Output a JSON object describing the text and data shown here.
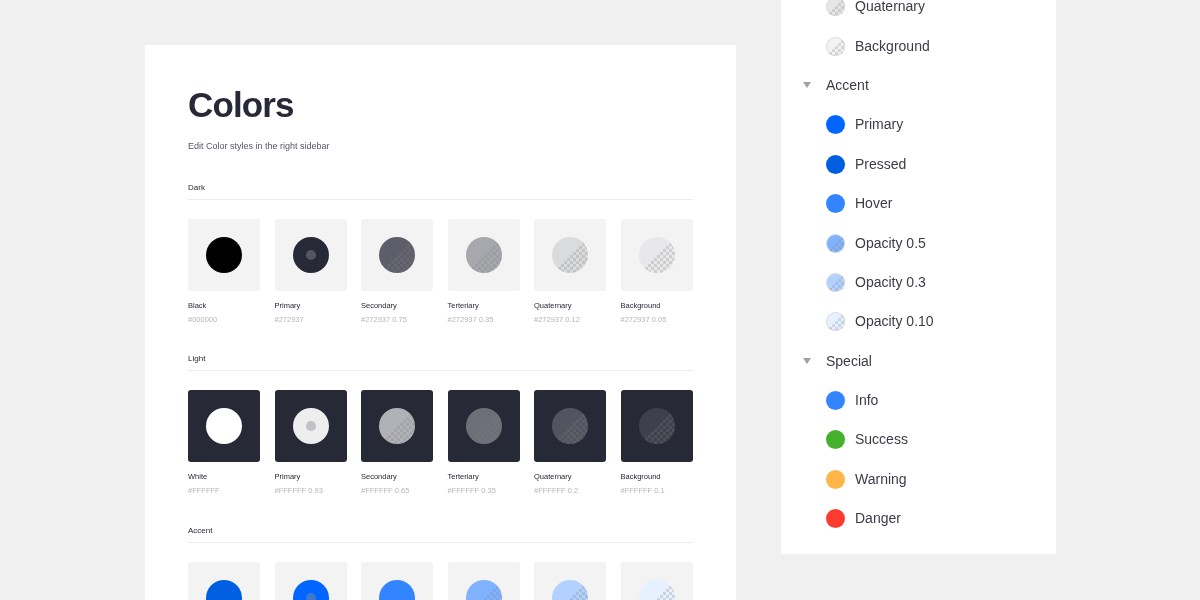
{
  "frame": {
    "title": "Colors",
    "subtitle": "Edit Color styles in the right sidebar",
    "sections": [
      {
        "label": "Dark",
        "inverted": false,
        "swatches": [
          {
            "name": "Black",
            "value": "#000000",
            "kind": "solid",
            "color": "#000000"
          },
          {
            "name": "Primary",
            "value": "#272937",
            "kind": "dot",
            "color": "#272937"
          },
          {
            "name": "Secondary",
            "value": "#272937 0.75",
            "kind": "checker",
            "color": "#5d5e69"
          },
          {
            "name": "Terteriary",
            "value": "#272937 0.35",
            "kind": "checker",
            "color": "#a7a8ae"
          },
          {
            "name": "Quaternary",
            "value": "#272937 0.12",
            "kind": "checker",
            "color": "#dadbdd"
          },
          {
            "name": "Background",
            "value": "#272937 0.05",
            "kind": "checker",
            "color": "#e8e8ea"
          }
        ]
      },
      {
        "label": "Light",
        "inverted": true,
        "swatches": [
          {
            "name": "White",
            "value": "#FFFFFF",
            "kind": "solid",
            "color": "#ffffff"
          },
          {
            "name": "Primary",
            "value": "#FFFFFF 0.93",
            "kind": "dot",
            "color": "#eeeeef"
          },
          {
            "name": "Secondary",
            "value": "#FFFFFF 0.65",
            "kind": "checker",
            "color": "#b1b2b7"
          },
          {
            "name": "Terteriary",
            "value": "#FFFFFF 0.35",
            "kind": "checker",
            "color": "#6d6e78"
          },
          {
            "name": "Quaternary",
            "value": "#FFFFFF 0.2",
            "kind": "checker",
            "color": "#52545f"
          },
          {
            "name": "Background",
            "value": "#FFFFFF 0.1",
            "kind": "checker",
            "color": "#3e404c"
          }
        ]
      },
      {
        "label": "Accent",
        "inverted": false,
        "swatches": [
          {
            "kind": "solid",
            "color": "#005fe0"
          },
          {
            "kind": "dot",
            "color": "#0066ff"
          },
          {
            "kind": "solid",
            "color": "#3385ff"
          },
          {
            "kind": "checker",
            "color": "#80b2ff"
          },
          {
            "kind": "checker",
            "color": "#b3d1ff"
          },
          {
            "kind": "checker",
            "color": "#e6f0ff"
          }
        ]
      }
    ]
  },
  "sidebar": {
    "groups": [
      {
        "items": [
          {
            "label": "Quaternary",
            "kind": "checker",
            "color": "#e6e6e8"
          },
          {
            "label": "Background",
            "kind": "checker",
            "color": "#f3f3f4"
          }
        ]
      },
      {
        "label": "Accent",
        "expanded": true,
        "items": [
          {
            "label": "Primary",
            "kind": "solid",
            "color": "#0066ff"
          },
          {
            "label": "Pressed",
            "kind": "solid",
            "color": "#005fe0"
          },
          {
            "label": "Hover",
            "kind": "solid",
            "color": "#3385ff"
          },
          {
            "label": "Opacity 0.5",
            "kind": "checker",
            "color": "#80b2ff"
          },
          {
            "label": "Opacity 0.3",
            "kind": "checker",
            "color": "#b3d1ff"
          },
          {
            "label": "Opacity 0.10",
            "kind": "checker",
            "color": "#e6f0ff"
          }
        ]
      },
      {
        "label": "Special",
        "expanded": true,
        "items": [
          {
            "label": "Info",
            "kind": "solid",
            "color": "#3385ff"
          },
          {
            "label": "Success",
            "kind": "solid",
            "color": "#45b02e"
          },
          {
            "label": "Warning",
            "kind": "solid",
            "color": "#ffb547"
          },
          {
            "label": "Danger",
            "kind": "solid",
            "color": "#ff3b30"
          }
        ]
      }
    ]
  }
}
